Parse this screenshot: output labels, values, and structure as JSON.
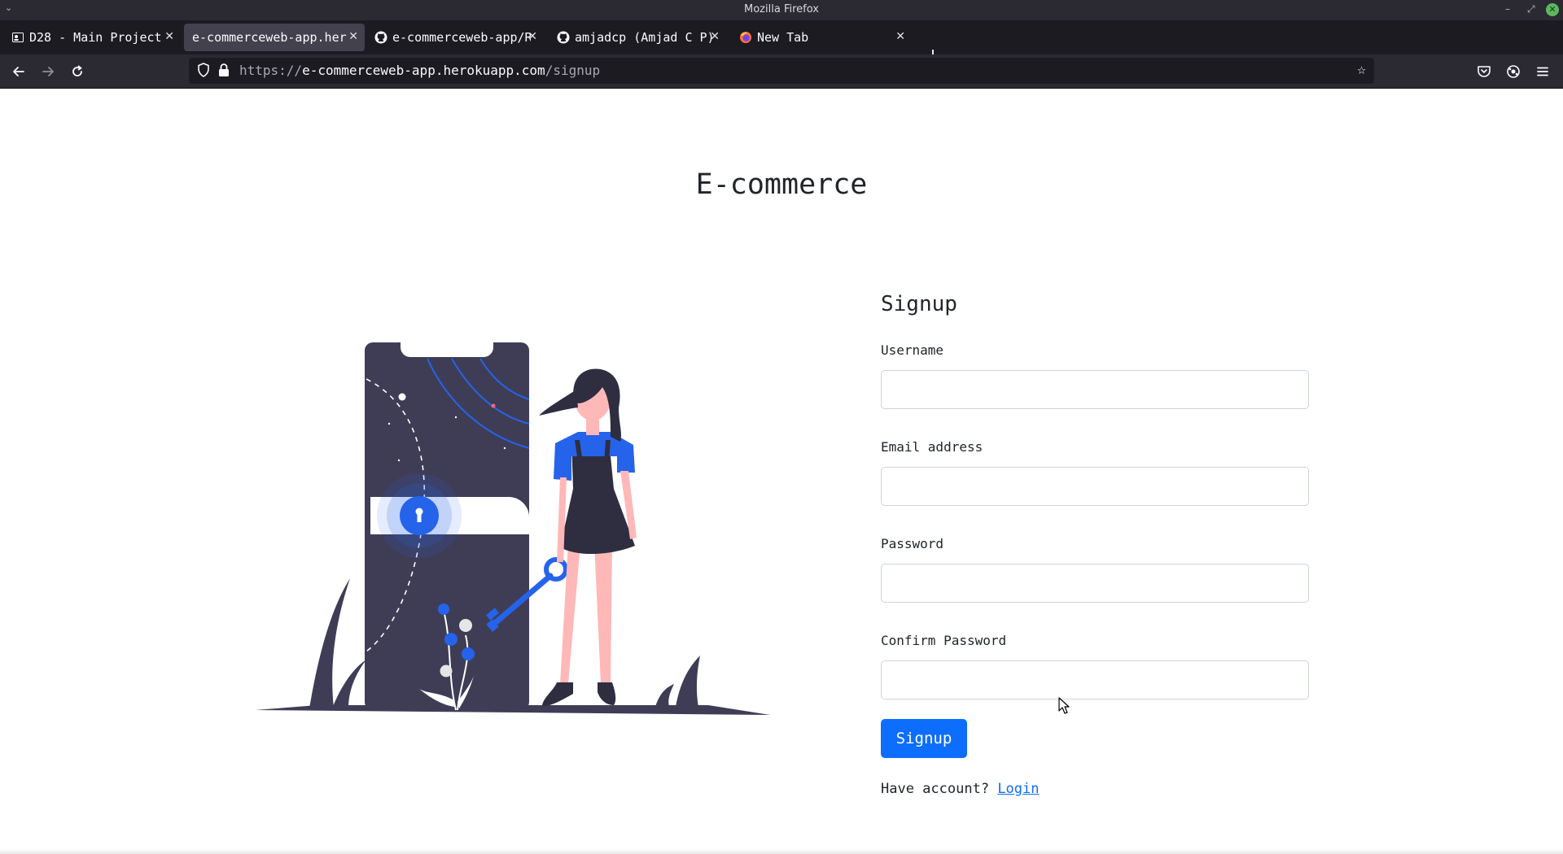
{
  "window": {
    "title": "Mozilla Firefox"
  },
  "tabs": [
    {
      "label": "D28 - Main Project",
      "icon": "contact-card-icon",
      "active": false
    },
    {
      "label": "e-commerceweb-app.herokuapp.com",
      "icon": "none",
      "active": true
    },
    {
      "label": "e-commerceweb-app/README",
      "icon": "github-icon",
      "active": false
    },
    {
      "label": "amjadcp (Amjad C P)",
      "icon": "github-icon",
      "active": false
    },
    {
      "label": "New Tab",
      "icon": "firefox-icon",
      "active": false
    }
  ],
  "urlbar": {
    "url_prefix": "https://",
    "url_host": "e-commerceweb-app.herokuapp.com",
    "url_path": "/signup"
  },
  "page": {
    "site_title": "E-commerce",
    "form": {
      "title": "Signup",
      "username_label": "Username",
      "username_value": "",
      "email_label": "Email address",
      "email_value": "",
      "password_label": "Password",
      "password_value": "",
      "confirm_label": "Confirm Password",
      "confirm_value": "",
      "submit_label": "Signup",
      "account_prompt": "Have account?",
      "login_link": "Login"
    }
  },
  "colors": {
    "accent": "#0d6efd",
    "illustration_dark": "#3f3d56",
    "illustration_blue": "#2563eb",
    "skin": "#ffb8b8"
  }
}
